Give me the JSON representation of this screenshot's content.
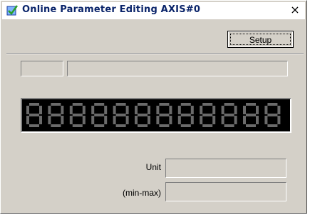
{
  "window": {
    "title": "Online Parameter Editing AXIS#0",
    "icon": "check-icon",
    "close_glyph": "×"
  },
  "toolbar": {
    "setup_label": "Setup"
  },
  "parameter": {
    "number_value": "",
    "name_value": "",
    "display_digits": 12
  },
  "fields": {
    "unit_label": "Unit",
    "unit_value": "",
    "range_label": "(min-max)",
    "range_value": ""
  },
  "colors": {
    "window_bg": "#d4d0c8",
    "title_text": "#0a246a",
    "display_bg": "#000000",
    "segment_off": "#6a6a6a"
  }
}
